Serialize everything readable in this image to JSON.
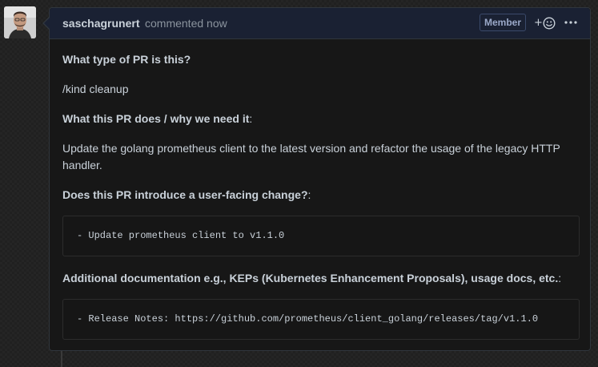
{
  "comment": {
    "author": "saschagrunert",
    "timestamp": "commented now",
    "badge": "Member"
  },
  "body": {
    "heading_pr_type": "What type of PR is this?",
    "kind": "/kind cleanup",
    "heading_what": "What this PR does / why we need it",
    "heading_what_suffix": ":",
    "description": "Update the golang prometheus client to the latest version and refactor the usage of the legacy HTTP handler.",
    "heading_user_facing": "Does this PR introduce a user-facing change?",
    "heading_user_facing_suffix": ":",
    "code_release_note": "- Update prometheus client to v1.1.0",
    "heading_docs": "Additional documentation e.g., KEPs (Kubernetes Enhancement Proposals), usage docs, etc.",
    "heading_docs_suffix": ":",
    "code_docs": "- Release Notes: https://github.com/prometheus/client_golang/releases/tag/v1.1.0"
  },
  "icons": {
    "avatar": "avatar",
    "reaction": "smiley-add-icon",
    "more": "kebab-horizontal-icon"
  }
}
